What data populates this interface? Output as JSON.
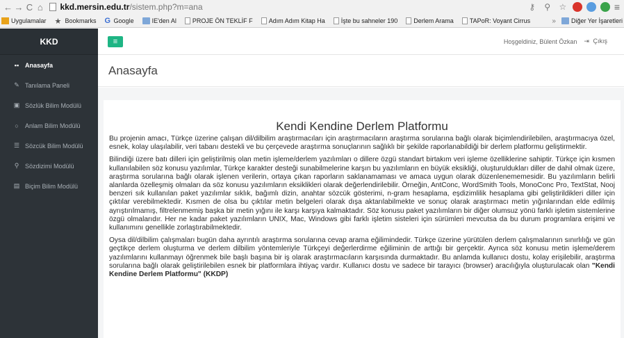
{
  "browser": {
    "url_host": "kkd.mersin.edu.tr",
    "url_path": "/sistem.php?m=ana",
    "bookmarks": [
      {
        "label": "Uygulamalar",
        "icon": "apps-icon"
      },
      {
        "label": "Bookmarks",
        "icon": "star-icon"
      },
      {
        "label": "Google",
        "icon": "google-icon"
      },
      {
        "label": "IE'den Al",
        "icon": "folder-icon"
      },
      {
        "label": "PROJE ÖN TEKLİF F",
        "icon": "page-icon"
      },
      {
        "label": "Adım Adım Kitap Ha",
        "icon": "page-icon"
      },
      {
        "label": "İşte bu sahneler 190",
        "icon": "page-icon"
      },
      {
        "label": "Derlem Arama",
        "icon": "page-icon"
      },
      {
        "label": "TAPoR: Voyant Cirrus",
        "icon": "page-icon"
      }
    ],
    "bookmarks_more": "»",
    "other_bookmarks": "Diğer Yer İşaretleri"
  },
  "sidebar": {
    "brand": "KKD",
    "items": [
      {
        "label": "Anasayfa",
        "icon": "grid-icon",
        "glyph": "▪▪",
        "active": true
      },
      {
        "label": "Tanılama Paneli",
        "icon": "pencil-icon",
        "glyph": "✎",
        "active": false
      },
      {
        "label": "Sözlük Bilim Modülü",
        "icon": "book-icon",
        "glyph": "▣",
        "active": false
      },
      {
        "label": "Anlam Bilim Modülü",
        "icon": "circle-icon",
        "glyph": "○",
        "active": false
      },
      {
        "label": "Sözcük Bilim Modülü",
        "icon": "list-icon",
        "glyph": "☰",
        "active": false
      },
      {
        "label": "Sözdizimi Modülü",
        "icon": "share-icon",
        "glyph": "⚲",
        "active": false
      },
      {
        "label": "Biçim Bilim Modülü",
        "icon": "file-icon",
        "glyph": "▤",
        "active": false
      }
    ]
  },
  "topbar": {
    "greeting": "Hoşgeldiniz, Bülent Özkan",
    "logout": "Çıkış"
  },
  "page": {
    "title": "Anasayfa"
  },
  "panel": {
    "title": "Kendi Kendine Derlem Platformu",
    "p1": "Bu projenin amacı, Türkçe üzerine çalışan dil/dilbilim araştırmacıları için araştırmacıların araştırma sorularına bağlı olarak biçimlendirilebilen, araştırmacıya özel, esnek, kolay ulaşılabilir, veri tabanı destekli ve bu çerçevede araştırma sonuçlarının sağlıklı bir şekilde raporlanabildiği bir derlem platformu geliştirmektir.",
    "p2": "Bilindiği üzere batı dilleri için geliştirilmiş olan metin işleme/derlem yazılımları o dillere özgü standart birtakım veri işleme özelliklerine sahiptir. Türkçe için kısmen kullanılabilen söz konusu yazılımlar, Türkçe karakter desteği sunabilmelerine karşın bu yazılımların en büyük eksikliği, oluşturuldukları diller de dahil olmak üzere, araştırma sorularına bağlı olarak işlenen verilerin, ortaya çıkan raporların saklanamaması ve amaca uygun olarak düzenlenememesidir. Bu yazılımların belirli alanlarda özelleşmiş olmaları da söz konusu yazılımların eksiklikleri olarak değerlendirilebilir. Örneğin, AntConc, WordSmith Tools, MonoConc Pro, TextStat, Nooj benzeri sık kullanılan paket yazılımlar sıklık, bağımlı dizin, anahtar sözcük gösterimi, n-gram hesaplama, eşdizimlilik hesaplama gibi geliştirildikleri diller için çıktılar verebilmektedir. Kısmen de olsa bu çıktılar metin belgeleri olarak dışa aktarılabilmekte ve sonuç olarak araştırmacı metin yığınlarından elde edilmiş ayrıştırılmamış, filtrelenmemiş başka bir metin yığını ile karşı karşıya kalmaktadır. Söz konusu paket yazılımların bir diğer olumsuz yönü farklı işletim sistemlerine özgü olmalarıdır. Her ne kadar paket yazılımların UNIX, Mac, Windows gibi farklı işletim sisteleri için sürümleri mevcutsa da bu durum programlara erişimi ve kullanımını genellikle zorlaştırabilmektedir.",
    "p3": "Oysa dil/dilbilim çalışmaları bugün daha ayrıntılı araştırma sorularına cevap arama eğilimindedir. Türkçe üzerine yürütülen derlem çalışmalarının sınırlılığı ve gün geçtikçe derlem oluşturma ve derlem dilbilim yöntemleriyle Türkçeyi değerlerdirme eğiliminin de arttığı bir gerçektir. Ayrıca söz konusu metin işleme/derem yazılımlarını kullanmayı öğrenmek bile başlı başına bir iş olarak araştırmacıların karşısında durmaktadır. Bu anlamda kullanıcı dostu, kolay erişilebilir, araştırma sorularına bağlı olarak geliştirilebilen esnek bir platformlara ihtiyaç vardır. Kullanıcı dostu ve sadece bir tarayıcı (browser) aracılığıyla oluşturulacak olan",
    "p3_bold": "\"Kendi Kendine Derlem Platformu\" (KKDP)"
  },
  "colors": {
    "sidebar_bg": "#2d3338",
    "accent": "#1eb584",
    "content_bg": "#f4f5f6"
  }
}
